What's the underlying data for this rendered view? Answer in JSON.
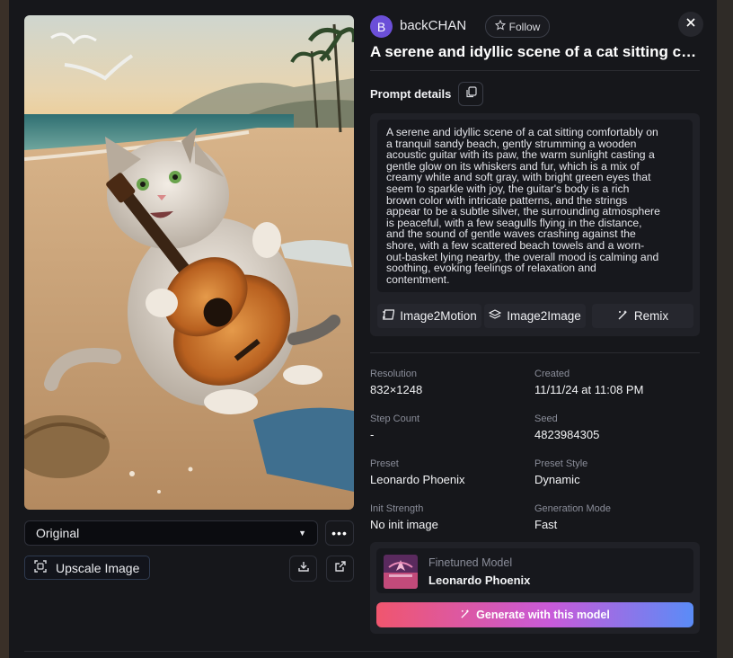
{
  "image": {
    "alt_icon": "cat-guitar-beach-image"
  },
  "controls": {
    "variant_selected": "Original",
    "more_icon": "more-horizontal-icon",
    "upscale_label": "Upscale Image",
    "download_icon": "download-icon",
    "open_icon": "external-link-icon"
  },
  "author": {
    "avatar_letter": "B",
    "avatar_color": "#6b4fd8",
    "name": "backCHAN",
    "follow_label": "Follow"
  },
  "title": "A serene and idyllic scene of a cat sitting com...",
  "prompt": {
    "label": "Prompt details",
    "lines": [
      "A serene and idyllic scene of a cat sitting comfortably on",
      "a tranquil sandy beach, gently strumming a wooden",
      "acoustic guitar with its paw, the warm sunlight casting a",
      "gentle glow on its whiskers and fur, which is a mix of",
      "creamy white and soft gray, with bright green eyes that",
      "seem to sparkle with joy, the guitar's body is a rich",
      "brown color with intricate patterns, and the strings",
      "appear to be a subtle silver, the surrounding atmosphere",
      "is peaceful, with a few seagulls flying in the distance,",
      "and the sound of gentle waves crashing against the",
      "shore, with a few scattered beach towels and a worn-",
      "out-basket lying nearby, the overall mood is calming and",
      "soothing, evoking feelings of relaxation and",
      "contentment."
    ]
  },
  "tools": {
    "image2motion": "Image2Motion",
    "image2image": "Image2Image",
    "remix": "Remix"
  },
  "info": {
    "resolution_label": "Resolution",
    "resolution_value": "832×1248",
    "created_label": "Created",
    "created_value": "11/11/24 at 11:08 PM",
    "step_label": "Step Count",
    "step_value": "-",
    "seed_label": "Seed",
    "seed_value": "4823984305",
    "preset_label": "Preset",
    "preset_value": "Leonardo Phoenix",
    "preset_style_label": "Preset Style",
    "preset_style_value": "Dynamic",
    "init_label": "Init Strength",
    "init_value": "No init image",
    "genmode_label": "Generation Mode",
    "genmode_value": "Fast"
  },
  "model": {
    "label": "Finetuned Model",
    "name": "Leonardo Phoenix",
    "generate_label": "Generate with this model",
    "gradient": [
      "#f0566e",
      "#c85ad9",
      "#5a8cf7"
    ]
  }
}
